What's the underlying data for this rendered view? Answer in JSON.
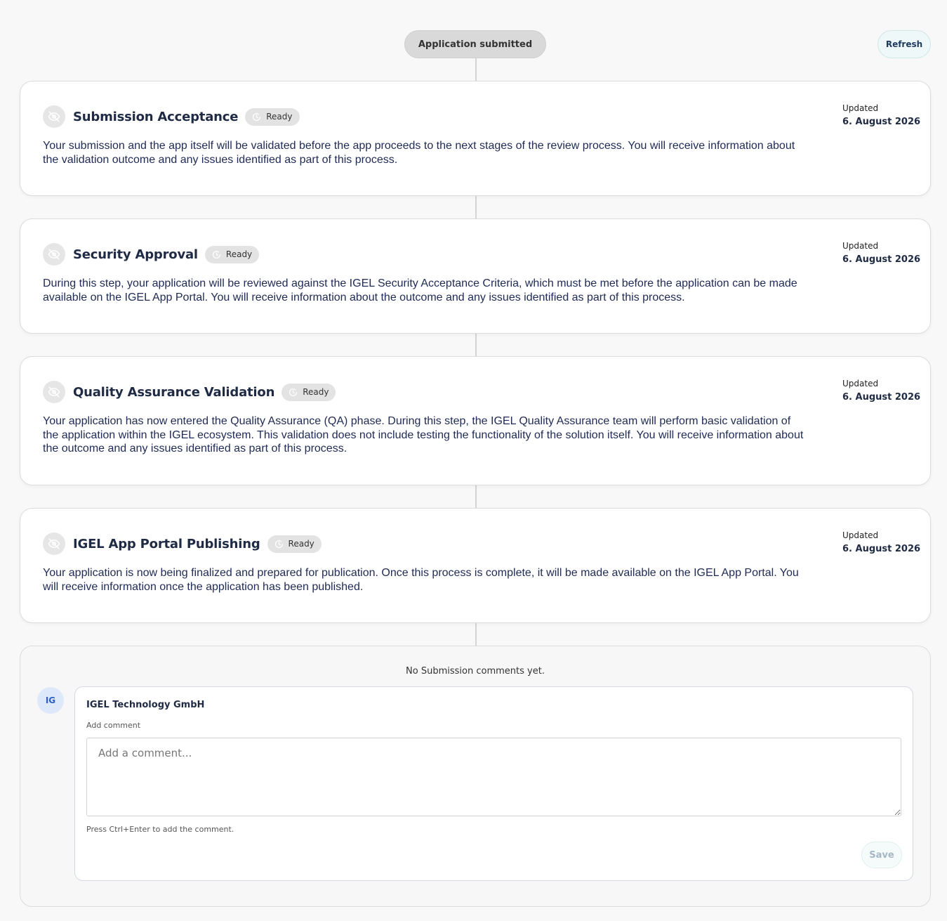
{
  "header": {
    "status_pill": "Application submitted",
    "refresh_label": "Refresh"
  },
  "steps": [
    {
      "title": "Submission Acceptance",
      "status": "Ready",
      "updated_label": "Updated",
      "updated_date": "6. August 2026",
      "description": "Your submission and the app itself will be validated before the app proceeds to the next stages of the review process. You will receive information about the validation outcome and any issues identified as part of this process."
    },
    {
      "title": "Security Approval",
      "status": "Ready",
      "updated_label": "Updated",
      "updated_date": "6. August 2026",
      "description": "During this step, your application will be reviewed against the IGEL Security Acceptance Criteria, which must be met before the application can be made available on the IGEL App Portal. You will receive information about the outcome and any issues identified as part of this process."
    },
    {
      "title": "Quality Assurance Validation",
      "status": "Ready",
      "updated_label": "Updated",
      "updated_date": "6. August 2026",
      "description": "Your application has now entered the Quality Assurance (QA) phase. During this step, the IGEL Quality Assurance team will perform basic validation of the application within the IGEL ecosystem. This validation does not include testing the functionality of the solution itself. You will receive information about the outcome and any issues identified as part of this process."
    },
    {
      "title": "IGEL App Portal Publishing",
      "status": "Ready",
      "updated_label": "Updated",
      "updated_date": "6. August 2026",
      "description": "Your application is now being finalized and prepared for publication. Once this process is complete, it will be made available on the IGEL App Portal. You will receive information once the application has been published."
    }
  ],
  "comments": {
    "empty_message": "No Submission comments yet.",
    "avatar_initials": "IG",
    "author": "IGEL Technology GmbH",
    "add_label": "Add comment",
    "placeholder": "Add a comment...",
    "hint": "Press Ctrl+Enter to add the comment.",
    "save_label": "Save"
  },
  "icons": {
    "step_icon": "eye-off-icon",
    "status_icon": "clock-icon"
  },
  "colors": {
    "text_primary": "#1f2a44",
    "badge_bg": "#e3e3e3",
    "avatar_bg": "#dde8fb",
    "avatar_text": "#2f5fc4"
  }
}
